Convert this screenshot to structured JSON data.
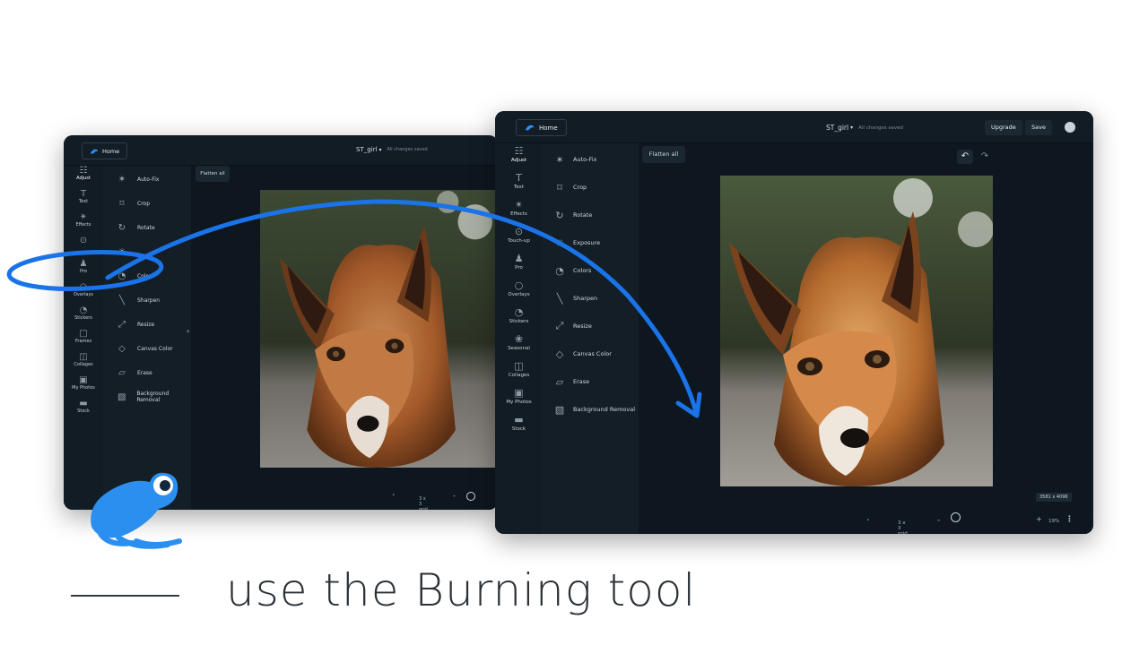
{
  "app": {
    "home_label": "Home",
    "doc_title": "ST_girl",
    "save_status": "All changes saved",
    "flatten_label": "Flatten all",
    "upgrade_label": "Upgrade",
    "save_label": "Save"
  },
  "window_a": {
    "rail": [
      {
        "label": "Adjust",
        "icon": "sliders-icon"
      },
      {
        "label": "Text",
        "icon": "text-icon"
      },
      {
        "label": "Effects",
        "icon": "sparkle-icon"
      },
      {
        "label": "",
        "icon": "touchup-icon"
      },
      {
        "label": "Pro",
        "icon": "pro-icon"
      },
      {
        "label": "Overlays",
        "icon": "overlays-icon"
      },
      {
        "label": "Stickers",
        "icon": "stickers-icon"
      },
      {
        "label": "Frames",
        "icon": "frames-icon"
      },
      {
        "label": "Collages",
        "icon": "collages-icon"
      },
      {
        "label": "My Photos",
        "icon": "photos-icon"
      },
      {
        "label": "Stock",
        "icon": "stock-icon"
      }
    ],
    "tools": [
      "Auto-Fix",
      "Crop",
      "Rotate",
      "",
      "Colors",
      "Sharpen",
      "Resize",
      "Canvas Color",
      "Erase",
      "Background Removal"
    ],
    "grid_label": "3 x 3 grid"
  },
  "window_b": {
    "rail": [
      {
        "label": "Adjust",
        "icon": "sliders-icon"
      },
      {
        "label": "Text",
        "icon": "text-icon"
      },
      {
        "label": "Effects",
        "icon": "sparkle-icon"
      },
      {
        "label": "Touch-up",
        "icon": "touchup-icon"
      },
      {
        "label": "Pro",
        "icon": "pro-icon"
      },
      {
        "label": "Overlays",
        "icon": "overlays-icon"
      },
      {
        "label": "Stickers",
        "icon": "stickers-icon"
      },
      {
        "label": "Seasonal",
        "icon": "seasonal-icon"
      },
      {
        "label": "Collages",
        "icon": "collages-icon"
      },
      {
        "label": "My Photos",
        "icon": "photos-icon"
      },
      {
        "label": "Stock",
        "icon": "stock-icon"
      }
    ],
    "tools": [
      "Auto-Fix",
      "Crop",
      "Rotate",
      "Exposure",
      "Colors",
      "Sharpen",
      "Resize",
      "Canvas Color",
      "Erase",
      "Background Removal"
    ],
    "grid_label": "3 x 3 grid",
    "dimensions": "3581 x 4096",
    "zoom": "19%"
  },
  "caption": "use the Burning tool",
  "colors": {
    "accent": "#1a73e8",
    "frog": "#2b8ff0",
    "app_bg": "#0f1820"
  }
}
